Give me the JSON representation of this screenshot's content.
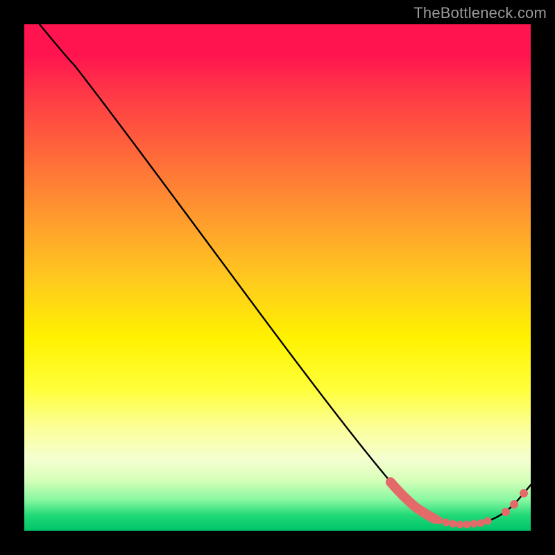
{
  "watermark": "TheBottleneck.com",
  "chart_data": {
    "type": "line",
    "title": "",
    "xlabel": "",
    "ylabel": "",
    "xlim": [
      0,
      100
    ],
    "ylim": [
      0,
      100
    ],
    "series": [
      {
        "name": "curve",
        "x": [
          3,
          6,
          10,
          16,
          24,
          34,
          44,
          54,
          62,
          68,
          72,
          76,
          78,
          80,
          82,
          84,
          86,
          88,
          90,
          92,
          94,
          97,
          100
        ],
        "y": [
          100,
          97,
          93,
          86,
          76,
          63,
          50,
          37,
          27,
          19,
          14,
          9,
          7,
          5,
          4,
          3.2,
          2.6,
          2.3,
          2.2,
          2.3,
          2.8,
          5.5,
          9
        ]
      }
    ],
    "markers": {
      "cluster_left": {
        "type": "thick-dots",
        "approx_x_range": [
          72,
          80
        ],
        "approx_y_range": [
          6,
          12
        ]
      },
      "cluster_bottom": {
        "type": "dots",
        "approx_x_range": [
          80,
          92
        ],
        "approx_y_range": [
          2,
          4
        ]
      },
      "cluster_right": {
        "type": "dots",
        "approx_x_range": [
          94,
          97
        ],
        "approx_y_range": [
          4,
          7
        ]
      }
    },
    "background": "rainbow-vertical-gradient (red→yellow→green)"
  }
}
